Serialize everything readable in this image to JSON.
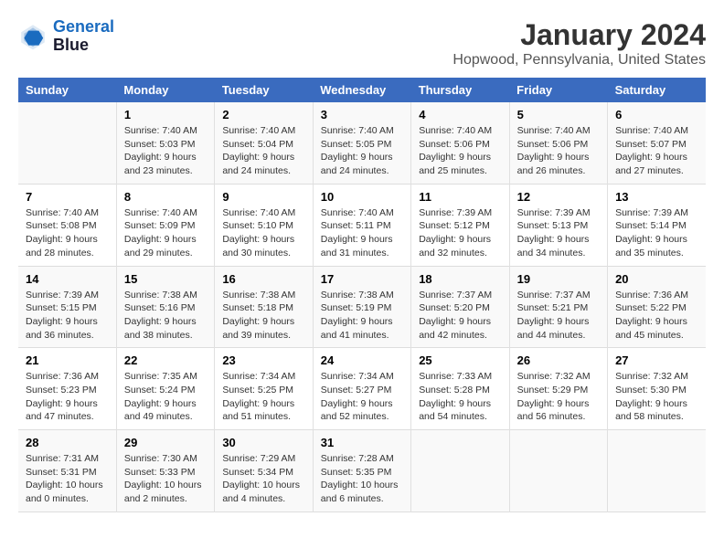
{
  "header": {
    "logo_line1": "General",
    "logo_line2": "Blue",
    "title": "January 2024",
    "subtitle": "Hopwood, Pennsylvania, United States"
  },
  "days_of_week": [
    "Sunday",
    "Monday",
    "Tuesday",
    "Wednesday",
    "Thursday",
    "Friday",
    "Saturday"
  ],
  "weeks": [
    [
      {
        "day": "",
        "sunrise": "",
        "sunset": "",
        "daylight": ""
      },
      {
        "day": "1",
        "sunrise": "Sunrise: 7:40 AM",
        "sunset": "Sunset: 5:03 PM",
        "daylight": "Daylight: 9 hours and 23 minutes."
      },
      {
        "day": "2",
        "sunrise": "Sunrise: 7:40 AM",
        "sunset": "Sunset: 5:04 PM",
        "daylight": "Daylight: 9 hours and 24 minutes."
      },
      {
        "day": "3",
        "sunrise": "Sunrise: 7:40 AM",
        "sunset": "Sunset: 5:05 PM",
        "daylight": "Daylight: 9 hours and 24 minutes."
      },
      {
        "day": "4",
        "sunrise": "Sunrise: 7:40 AM",
        "sunset": "Sunset: 5:06 PM",
        "daylight": "Daylight: 9 hours and 25 minutes."
      },
      {
        "day": "5",
        "sunrise": "Sunrise: 7:40 AM",
        "sunset": "Sunset: 5:06 PM",
        "daylight": "Daylight: 9 hours and 26 minutes."
      },
      {
        "day": "6",
        "sunrise": "Sunrise: 7:40 AM",
        "sunset": "Sunset: 5:07 PM",
        "daylight": "Daylight: 9 hours and 27 minutes."
      }
    ],
    [
      {
        "day": "7",
        "sunrise": "Sunrise: 7:40 AM",
        "sunset": "Sunset: 5:08 PM",
        "daylight": "Daylight: 9 hours and 28 minutes."
      },
      {
        "day": "8",
        "sunrise": "Sunrise: 7:40 AM",
        "sunset": "Sunset: 5:09 PM",
        "daylight": "Daylight: 9 hours and 29 minutes."
      },
      {
        "day": "9",
        "sunrise": "Sunrise: 7:40 AM",
        "sunset": "Sunset: 5:10 PM",
        "daylight": "Daylight: 9 hours and 30 minutes."
      },
      {
        "day": "10",
        "sunrise": "Sunrise: 7:40 AM",
        "sunset": "Sunset: 5:11 PM",
        "daylight": "Daylight: 9 hours and 31 minutes."
      },
      {
        "day": "11",
        "sunrise": "Sunrise: 7:39 AM",
        "sunset": "Sunset: 5:12 PM",
        "daylight": "Daylight: 9 hours and 32 minutes."
      },
      {
        "day": "12",
        "sunrise": "Sunrise: 7:39 AM",
        "sunset": "Sunset: 5:13 PM",
        "daylight": "Daylight: 9 hours and 34 minutes."
      },
      {
        "day": "13",
        "sunrise": "Sunrise: 7:39 AM",
        "sunset": "Sunset: 5:14 PM",
        "daylight": "Daylight: 9 hours and 35 minutes."
      }
    ],
    [
      {
        "day": "14",
        "sunrise": "Sunrise: 7:39 AM",
        "sunset": "Sunset: 5:15 PM",
        "daylight": "Daylight: 9 hours and 36 minutes."
      },
      {
        "day": "15",
        "sunrise": "Sunrise: 7:38 AM",
        "sunset": "Sunset: 5:16 PM",
        "daylight": "Daylight: 9 hours and 38 minutes."
      },
      {
        "day": "16",
        "sunrise": "Sunrise: 7:38 AM",
        "sunset": "Sunset: 5:18 PM",
        "daylight": "Daylight: 9 hours and 39 minutes."
      },
      {
        "day": "17",
        "sunrise": "Sunrise: 7:38 AM",
        "sunset": "Sunset: 5:19 PM",
        "daylight": "Daylight: 9 hours and 41 minutes."
      },
      {
        "day": "18",
        "sunrise": "Sunrise: 7:37 AM",
        "sunset": "Sunset: 5:20 PM",
        "daylight": "Daylight: 9 hours and 42 minutes."
      },
      {
        "day": "19",
        "sunrise": "Sunrise: 7:37 AM",
        "sunset": "Sunset: 5:21 PM",
        "daylight": "Daylight: 9 hours and 44 minutes."
      },
      {
        "day": "20",
        "sunrise": "Sunrise: 7:36 AM",
        "sunset": "Sunset: 5:22 PM",
        "daylight": "Daylight: 9 hours and 45 minutes."
      }
    ],
    [
      {
        "day": "21",
        "sunrise": "Sunrise: 7:36 AM",
        "sunset": "Sunset: 5:23 PM",
        "daylight": "Daylight: 9 hours and 47 minutes."
      },
      {
        "day": "22",
        "sunrise": "Sunrise: 7:35 AM",
        "sunset": "Sunset: 5:24 PM",
        "daylight": "Daylight: 9 hours and 49 minutes."
      },
      {
        "day": "23",
        "sunrise": "Sunrise: 7:34 AM",
        "sunset": "Sunset: 5:25 PM",
        "daylight": "Daylight: 9 hours and 51 minutes."
      },
      {
        "day": "24",
        "sunrise": "Sunrise: 7:34 AM",
        "sunset": "Sunset: 5:27 PM",
        "daylight": "Daylight: 9 hours and 52 minutes."
      },
      {
        "day": "25",
        "sunrise": "Sunrise: 7:33 AM",
        "sunset": "Sunset: 5:28 PM",
        "daylight": "Daylight: 9 hours and 54 minutes."
      },
      {
        "day": "26",
        "sunrise": "Sunrise: 7:32 AM",
        "sunset": "Sunset: 5:29 PM",
        "daylight": "Daylight: 9 hours and 56 minutes."
      },
      {
        "day": "27",
        "sunrise": "Sunrise: 7:32 AM",
        "sunset": "Sunset: 5:30 PM",
        "daylight": "Daylight: 9 hours and 58 minutes."
      }
    ],
    [
      {
        "day": "28",
        "sunrise": "Sunrise: 7:31 AM",
        "sunset": "Sunset: 5:31 PM",
        "daylight": "Daylight: 10 hours and 0 minutes."
      },
      {
        "day": "29",
        "sunrise": "Sunrise: 7:30 AM",
        "sunset": "Sunset: 5:33 PM",
        "daylight": "Daylight: 10 hours and 2 minutes."
      },
      {
        "day": "30",
        "sunrise": "Sunrise: 7:29 AM",
        "sunset": "Sunset: 5:34 PM",
        "daylight": "Daylight: 10 hours and 4 minutes."
      },
      {
        "day": "31",
        "sunrise": "Sunrise: 7:28 AM",
        "sunset": "Sunset: 5:35 PM",
        "daylight": "Daylight: 10 hours and 6 minutes."
      },
      {
        "day": "",
        "sunrise": "",
        "sunset": "",
        "daylight": ""
      },
      {
        "day": "",
        "sunrise": "",
        "sunset": "",
        "daylight": ""
      },
      {
        "day": "",
        "sunrise": "",
        "sunset": "",
        "daylight": ""
      }
    ]
  ]
}
